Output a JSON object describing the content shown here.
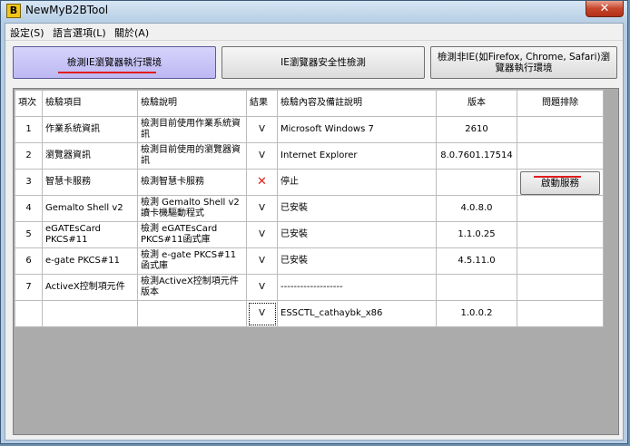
{
  "window": {
    "title": "NewMyB2BTool",
    "icon_letter": "B",
    "close_symbol": "✕"
  },
  "menu": [
    {
      "label": "設定(S)"
    },
    {
      "label": "語言選項(L)"
    },
    {
      "label": "關於(A)"
    }
  ],
  "toolbar": {
    "btn_ie": "檢測IE瀏覽器執行環境",
    "btn_security": "IE瀏覽器安全性檢測",
    "btn_nonie": "檢測非IE(如Firefox, Chrome, Safari)瀏覽器執行環境"
  },
  "table": {
    "headers": [
      "項次",
      "檢驗項目",
      "檢驗說明",
      "結果",
      "檢驗內容及備註說明",
      "版本",
      "問題排除"
    ],
    "rows": [
      {
        "no": "1",
        "item": "作業系統資訊",
        "desc": "檢測目前使用作業系統資訊",
        "result": "V",
        "content": "Microsoft Windows 7",
        "version": "2610",
        "fix": ""
      },
      {
        "no": "2",
        "item": "瀏覽器資訊",
        "desc": "檢測目前使用的瀏覽器資訊",
        "result": "V",
        "content": "Internet Explorer",
        "version": "8.0.7601.17514",
        "fix": ""
      },
      {
        "no": "3",
        "item": "智慧卡服務",
        "desc": "檢測智慧卡服務",
        "result": "✕",
        "content": "停止",
        "version": "",
        "fix": "啟動服務"
      },
      {
        "no": "4",
        "item": "Gemalto Shell v2",
        "desc": "檢測 Gemalto Shell v2 讀卡機驅動程式",
        "result": "V",
        "content": "已安裝",
        "version": "4.0.8.0",
        "fix": ""
      },
      {
        "no": "5",
        "item": "eGATEsCard PKCS#11",
        "desc": "檢測 eGATEsCard PKCS#11函式庫",
        "result": "V",
        "content": "已安裝",
        "version": "1.1.0.25",
        "fix": ""
      },
      {
        "no": "6",
        "item": "e-gate PKCS#11",
        "desc": "檢測 e-gate PKCS#11函式庫",
        "result": "V",
        "content": "已安裝",
        "version": "4.5.11.0",
        "fix": ""
      },
      {
        "no": "7",
        "item": "ActiveX控制項元件",
        "desc": "檢測ActiveX控制項元件版本",
        "result": "V",
        "content": "-------------------",
        "version": "",
        "fix": ""
      },
      {
        "no": "",
        "item": "",
        "desc": "",
        "result": "V",
        "content": "ESSCTL_cathaybk_x86",
        "version": "1.0.0.2",
        "fix": ""
      }
    ]
  },
  "colors": {
    "active_button": "#c8c4f8",
    "highlight_underline": "#e11d1d",
    "fail_mark": "#e02020"
  }
}
